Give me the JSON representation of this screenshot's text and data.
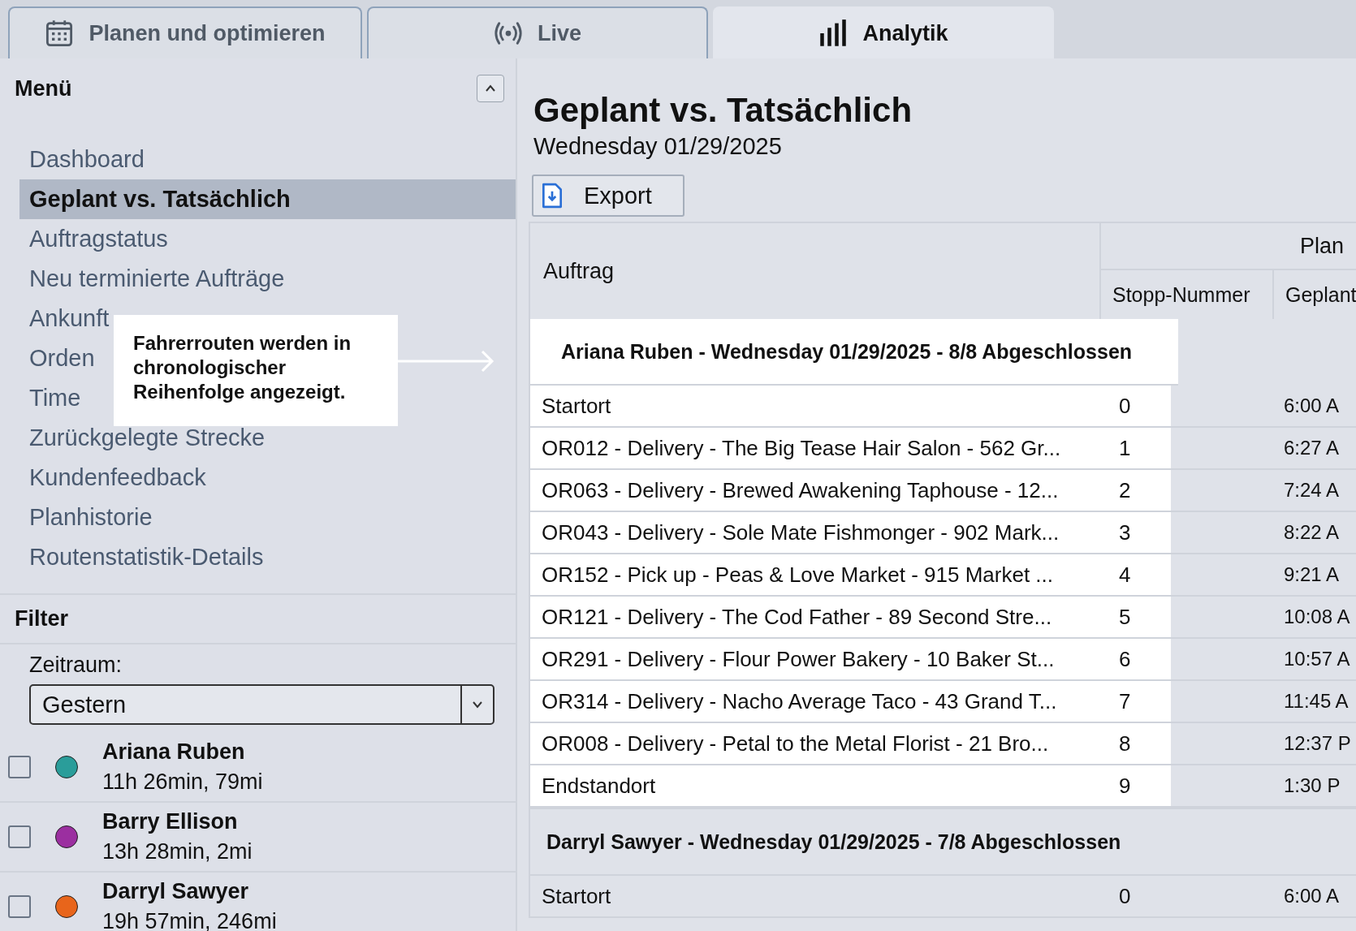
{
  "tabs": [
    {
      "label": "Planen und optimieren",
      "kind": "calendar",
      "selected": false
    },
    {
      "label": "Live",
      "kind": "broadcast",
      "selected": false
    },
    {
      "label": "Analytik",
      "kind": "chart",
      "selected": true
    }
  ],
  "menu": {
    "title": "Menü",
    "expanded": true,
    "items": [
      {
        "label": "Dashboard",
        "selected": false
      },
      {
        "label": "Geplant vs. Tatsächlich",
        "selected": true
      },
      {
        "label": "Auftragstatus",
        "selected": false
      },
      {
        "label": "Neu terminierte Aufträge",
        "selected": false
      },
      {
        "label": "Ankunft",
        "selected": false
      },
      {
        "label": "Orden",
        "selected": false
      },
      {
        "label": "Time",
        "selected": false
      },
      {
        "label": "Zurückgelegte Strecke",
        "selected": false
      },
      {
        "label": "Kundenfeedback",
        "selected": false
      },
      {
        "label": "Planhistorie",
        "selected": false
      },
      {
        "label": "Routenstatistik-Details",
        "selected": false
      }
    ]
  },
  "filter": {
    "title": "Filter",
    "period_label": "Zeitraum:",
    "period_value": "Gestern",
    "drivers": [
      {
        "name": "Ariana Ruben",
        "summary": "11h 26min, 79mi",
        "checked": false,
        "color": "#2a9d9a"
      },
      {
        "name": "Barry Ellison",
        "summary": "13h 28min, 2mi",
        "checked": false,
        "color": "#9b2fa0"
      },
      {
        "name": "Darryl Sawyer",
        "summary": "19h 57min, 246mi",
        "checked": false,
        "color": "#e8651b"
      }
    ]
  },
  "callout": {
    "text": "Fahrerrouten werden in chronologischer Reihenfolge angezeigt."
  },
  "page": {
    "title": "Geplant vs. Tatsächlich",
    "subtitle": "Wednesday 01/29/2025",
    "export_button": "Export"
  },
  "table": {
    "order_column": "Auftrag",
    "plan_group": "Plan",
    "plan_columns": [
      "Stopp-Nummer",
      "Geplant"
    ],
    "groups": [
      {
        "title": "Ariana Ruben - Wednesday 01/29/2025 - 8/8 Abgeschlossen",
        "highlighted": true,
        "rows": [
          {
            "order": "Startort",
            "stop": "0",
            "planned": "6:00 A"
          },
          {
            "order": "OR012 - Delivery - The Big Tease Hair Salon - 562 Gr...",
            "stop": "1",
            "planned": "6:27 A"
          },
          {
            "order": "OR063 - Delivery - Brewed Awakening Taphouse - 12...",
            "stop": "2",
            "planned": "7:24 A"
          },
          {
            "order": "OR043 - Delivery - Sole Mate Fishmonger - 902 Mark...",
            "stop": "3",
            "planned": "8:22 A"
          },
          {
            "order": "OR152 - Pick up - Peas & Love Market - 915 Market ...",
            "stop": "4",
            "planned": "9:21 A"
          },
          {
            "order": "OR121 - Delivery - The Cod Father - 89 Second Stre...",
            "stop": "5",
            "planned": "10:08 A"
          },
          {
            "order": "OR291 - Delivery - Flour Power Bakery - 10 Baker St...",
            "stop": "6",
            "planned": "10:57 A"
          },
          {
            "order": "OR314 - Delivery - Nacho Average Taco - 43 Grand T...",
            "stop": "7",
            "planned": "11:45 A"
          },
          {
            "order": "OR008 - Delivery - Petal to the Metal Florist - 21 Bro...",
            "stop": "8",
            "planned": "12:37 P"
          },
          {
            "order": "Endstandort",
            "stop": "9",
            "planned": "1:30 P"
          }
        ]
      },
      {
        "title": "Darryl Sawyer - Wednesday 01/29/2025 - 7/8 Abgeschlossen",
        "highlighted": false,
        "rows": [
          {
            "order": "Startort",
            "stop": "0",
            "planned": "6:00 A"
          }
        ]
      }
    ]
  }
}
